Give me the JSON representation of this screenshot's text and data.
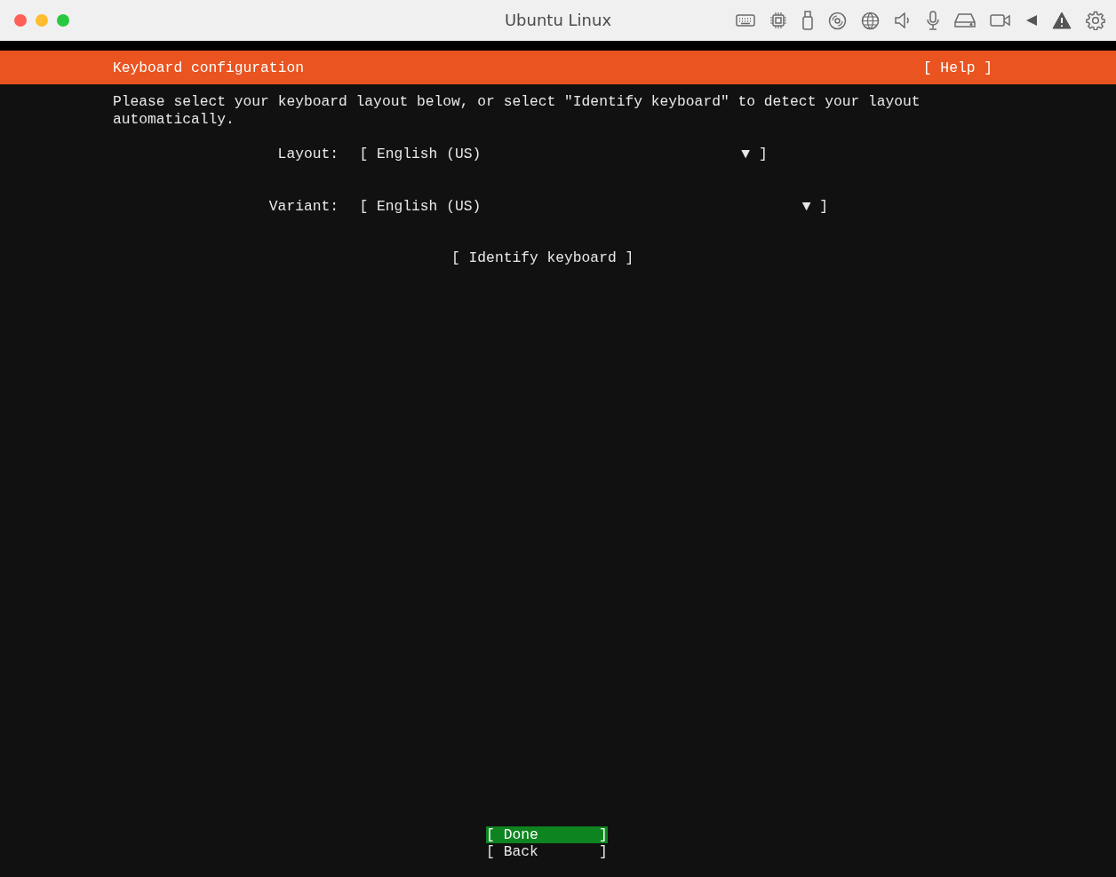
{
  "window": {
    "title": "Ubuntu Linux"
  },
  "header": {
    "title": "Keyboard configuration",
    "help": "[ Help ]"
  },
  "instructions": "Please select your keyboard layout below, or select \"Identify keyboard\" to detect your layout automatically.",
  "fields": [
    {
      "label": "Layout:",
      "value": "[ English (US)",
      "arrow": "▼ ]",
      "kind": "short"
    },
    {
      "label": "Variant:",
      "value": "[ English (US)",
      "arrow": "▼ ]",
      "kind": "long"
    }
  ],
  "identify_button": "[ Identify keyboard ]",
  "buttons": [
    {
      "label": "[ Done",
      "end": "]",
      "selected": true
    },
    {
      "label": "[ Back",
      "end": "]",
      "selected": false
    }
  ]
}
